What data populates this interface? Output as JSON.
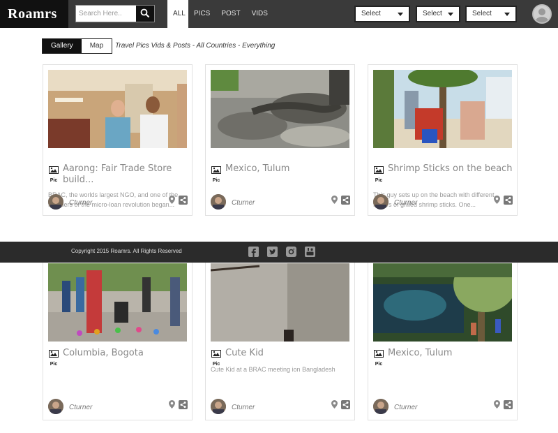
{
  "header": {
    "logo": "Roamrs",
    "search_placeholder": "Search Here..",
    "nav_tabs": [
      "ALL",
      "PICS",
      "POST",
      "VIDS"
    ],
    "active_tab": "ALL",
    "selects": [
      "Select",
      "Select",
      "Select"
    ]
  },
  "toolbar": {
    "gallery_label": "Gallery",
    "map_label": "Map",
    "tagline": "Travel Pics Vids & Posts - All Countries - Everything"
  },
  "cards": [
    {
      "title": "Aarong: Fair Trade Store build...",
      "type": "Pic",
      "description": "BRAC, the worlds largest NGO, and one of the founders of the micro-loan revolution began...",
      "author": "Cturner"
    },
    {
      "title": "Mexico, Tulum",
      "type": "Pic",
      "description": "",
      "author": "Cturner"
    },
    {
      "title": "Shrimp Sticks on the beach",
      "type": "Pic",
      "description": "This guy sets up on the beach with different flavors of grilled shrimp sticks. One...",
      "author": "Cturner"
    },
    {
      "title": "Columbia, Bogota",
      "type": "Pic",
      "description": "",
      "author": "Cturner"
    },
    {
      "title": "Cute Kid",
      "type": "Pic",
      "description": "Cute Kid at a BRAC meeting ion Bangladesh",
      "author": "Cturner"
    },
    {
      "title": "Mexico, Tulum",
      "type": "Pic",
      "description": "",
      "author": "Cturner"
    }
  ],
  "footer": {
    "copyright": "Copyright 2015 Roamrs. All Rights Reserved",
    "social_icons": [
      "facebook-icon",
      "twitter-icon",
      "instagram-icon",
      "youtube-icon"
    ]
  },
  "colors": {
    "topbar": "#3a3a3a",
    "logo_bg": "#111111",
    "footer": "#2b2b2b",
    "card_border": "#e1e1e1"
  }
}
